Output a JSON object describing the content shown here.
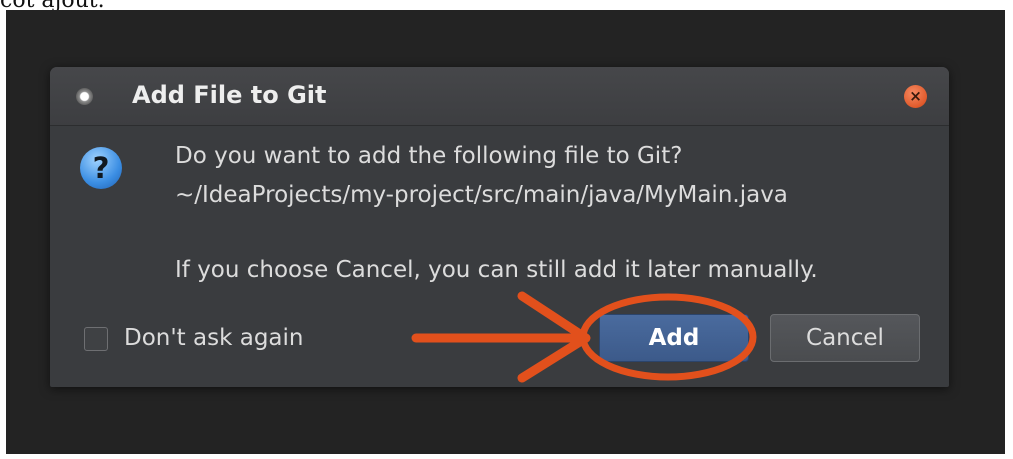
{
  "page": {
    "caption_fragment": "cot ajout."
  },
  "dialog": {
    "title": "Add File to Git",
    "window_icon": "window-menu-dot-icon",
    "close_icon": "close-icon",
    "close_glyph": "×",
    "message_icon": "question-icon",
    "message_icon_glyph": "?",
    "message_line1": "Do you want to add the following file to Git?",
    "message_line2": "~/IdeaProjects/my-project/src/main/java/MyMain.java",
    "message_line3": "If you choose Cancel, you can still add it later manually.",
    "checkbox_label": "Don't ask again",
    "checkbox_checked": false,
    "add_label": "Add",
    "cancel_label": "Cancel"
  },
  "colors": {
    "background": "#232323",
    "dialog": "#3a3c3f",
    "primary_button": "#3c5a8a",
    "close_button": "#e05a2b",
    "annotation": "#e2501c"
  },
  "annotation": {
    "arrow_target": "add-button",
    "highlight_shape": "ellipse"
  }
}
